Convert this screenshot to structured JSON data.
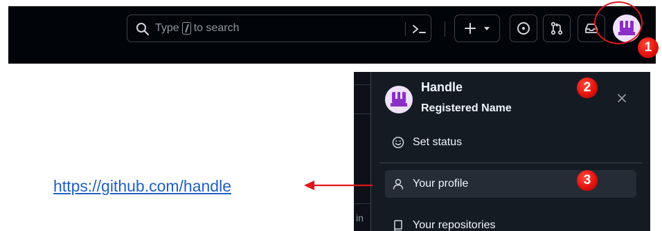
{
  "header": {
    "search": {
      "placeholder_before": "Type",
      "placeholder_key": "/",
      "placeholder_after": "to search"
    },
    "buttons": {
      "create": "plus-icon",
      "create_menu": "triangle-down-icon",
      "issues": "issue-opened-icon",
      "pull_requests": "git-pull-request-icon",
      "inbox": "inbox-icon",
      "avatar": "avatar"
    }
  },
  "dropdown": {
    "handle": "Handle",
    "registered_name": "Registered Name",
    "items": [
      {
        "label": "Set status",
        "icon": "smiley-icon"
      },
      {
        "label": "Your profile",
        "icon": "person-icon"
      },
      {
        "label": "Your repositories",
        "icon": "repo-icon"
      }
    ],
    "side_text": "in"
  },
  "annotations": {
    "badges": [
      "1",
      "2",
      "3"
    ],
    "url": "https://github.com/handle"
  },
  "colors": {
    "header_bg": "#010409",
    "panel_bg": "#151b23",
    "hover_bg": "#262c36",
    "highlight_red": "#e0141a",
    "link_blue": "#1f5fc8",
    "avatar_purple": "#8b2ec7"
  }
}
